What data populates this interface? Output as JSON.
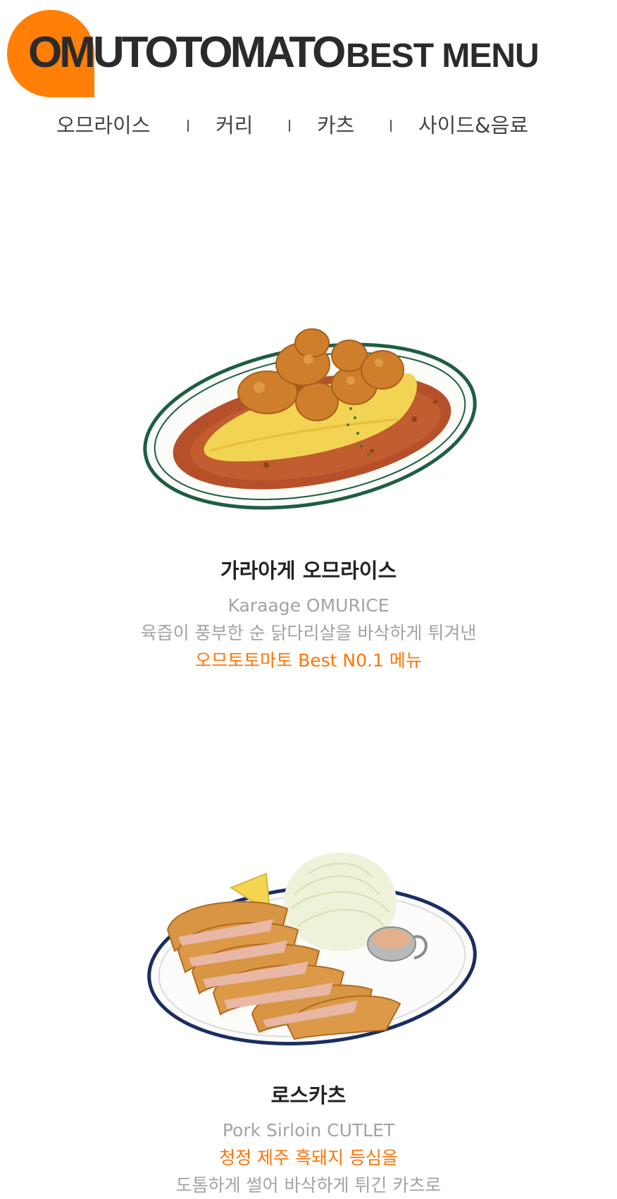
{
  "header": {
    "brand": "OMUTOTOMATO",
    "subtitle": "BEST MENU",
    "accent_color": "#ff7f07"
  },
  "nav": {
    "items": [
      {
        "label": "오므라이스"
      },
      {
        "label": "커리"
      },
      {
        "label": "카츠"
      },
      {
        "label": "사이드&음료"
      }
    ]
  },
  "menu": [
    {
      "name": "가라아게 오므라이스",
      "english": "Karaage OMURICE",
      "desc_1": "육즙이 풍부한 순 닭다리살을 바삭하게 튀겨낸",
      "desc_2": "오므토토마토 Best N0.1 메뉴",
      "image": "karaage-omurice-plate"
    },
    {
      "name": "로스카츠",
      "english": "Pork Sirloin CUTLET",
      "desc_1": "청정 제주 흑돼지 등심을",
      "desc_2": "도톰하게 썰어 바삭하게 튀긴 카츠로",
      "image": "pork-cutlet-plate"
    }
  ]
}
